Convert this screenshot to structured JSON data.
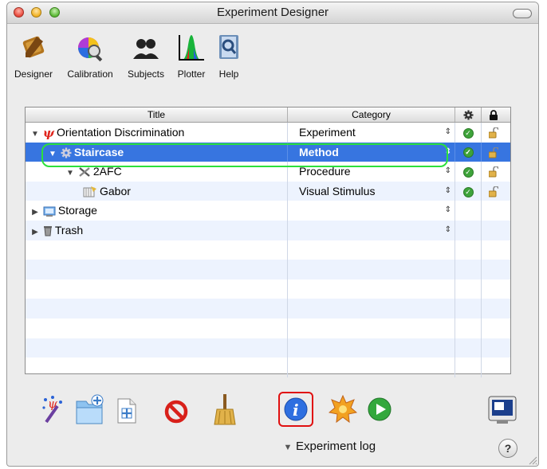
{
  "window": {
    "title": "Experiment Designer"
  },
  "toolbar": {
    "items": [
      {
        "label": "Designer",
        "icon": "designer-icon"
      },
      {
        "label": "Calibration",
        "icon": "color-wheel-icon"
      },
      {
        "label": "Subjects",
        "icon": "people-icon"
      },
      {
        "label": "Plotter",
        "icon": "plot-icon"
      },
      {
        "label": "Help",
        "icon": "help-book-icon"
      }
    ]
  },
  "table": {
    "columns": {
      "title": "Title",
      "category": "Category",
      "status": "gear-icon",
      "lock": "lock-icon"
    },
    "rows": [
      {
        "title": "Orientation Discrimination",
        "category": "Experiment",
        "indent": 0,
        "expanded": true,
        "icon": "psi-icon",
        "status": "check",
        "lock": "unlocked",
        "selected": false
      },
      {
        "title": "Staircase",
        "category": "Method",
        "indent": 1,
        "expanded": true,
        "icon": "gear-icon",
        "status": "check",
        "lock": "unlocked",
        "selected": true
      },
      {
        "title": "2AFC",
        "category": "Procedure",
        "indent": 2,
        "expanded": true,
        "icon": "tools-icon",
        "status": "check",
        "lock": "unlocked",
        "selected": false
      },
      {
        "title": "Gabor",
        "category": "Visual Stimulus",
        "indent": 3,
        "expanded": false,
        "icon": "stimulus-icon",
        "status": "check",
        "lock": "unlocked",
        "selected": false
      },
      {
        "title": "Storage",
        "category": "",
        "indent": 0,
        "expanded": false,
        "icon": "storage-icon",
        "status": "",
        "lock": "",
        "selected": false
      },
      {
        "title": "Trash",
        "category": "",
        "indent": 0,
        "expanded": false,
        "icon": "trash-icon",
        "status": "",
        "lock": "",
        "selected": false
      }
    ],
    "empty_rows": 7
  },
  "bottom": {
    "buttons": [
      "new-experiment-wand-icon",
      "new-folder-icon",
      "new-document-icon",
      "delete-icon",
      "clean-broom-icon",
      "info-icon",
      "run-badge-icon",
      "play-icon",
      "display-icon"
    ],
    "log_label": "Experiment log",
    "help_label": "?"
  },
  "colors": {
    "selection": "#3775e0",
    "highlight_green": "#2ce03c",
    "highlight_red": "#e01010"
  }
}
